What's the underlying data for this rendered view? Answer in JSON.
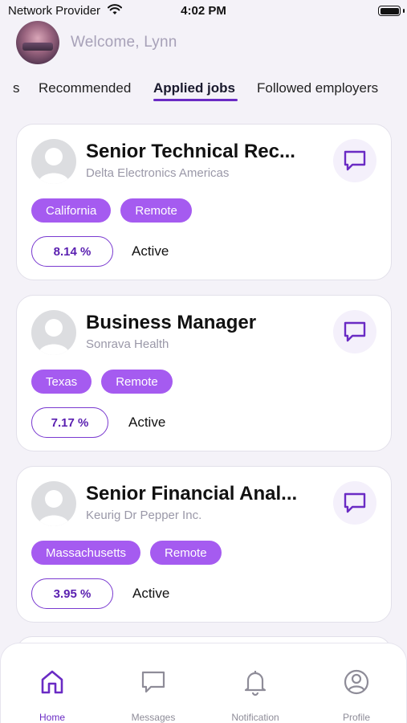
{
  "status_bar": {
    "carrier": "Network Provider",
    "time": "4:02 PM"
  },
  "header": {
    "welcome": "Welcome, Lynn"
  },
  "tabs": [
    {
      "label": "s"
    },
    {
      "label": "Recommended"
    },
    {
      "label": "Applied jobs",
      "active": true
    },
    {
      "label": "Followed employers"
    }
  ],
  "jobs": [
    {
      "title": "Senior Technical Rec...",
      "company": "Delta Electronics Americas",
      "tags": [
        "California",
        "Remote"
      ],
      "match": "8.14 %",
      "status": "Active"
    },
    {
      "title": "Business Manager",
      "company": "Sonrava Health",
      "tags": [
        "Texas",
        "Remote"
      ],
      "match": "7.17 %",
      "status": "Active"
    },
    {
      "title": "Senior Financial Anal...",
      "company": "Keurig Dr Pepper Inc.",
      "tags": [
        "Massachusetts",
        "Remote"
      ],
      "match": "3.95 %",
      "status": "Active"
    }
  ],
  "nav": [
    {
      "label": "Home",
      "icon": "home-icon",
      "active": true
    },
    {
      "label": "Messages",
      "icon": "message-icon"
    },
    {
      "label": "Notification",
      "icon": "bell-icon"
    },
    {
      "label": "Profile",
      "icon": "profile-icon"
    }
  ],
  "colors": {
    "accent": "#6a2bc4",
    "tag": "#a55bf0",
    "background": "#f4f2f8"
  }
}
